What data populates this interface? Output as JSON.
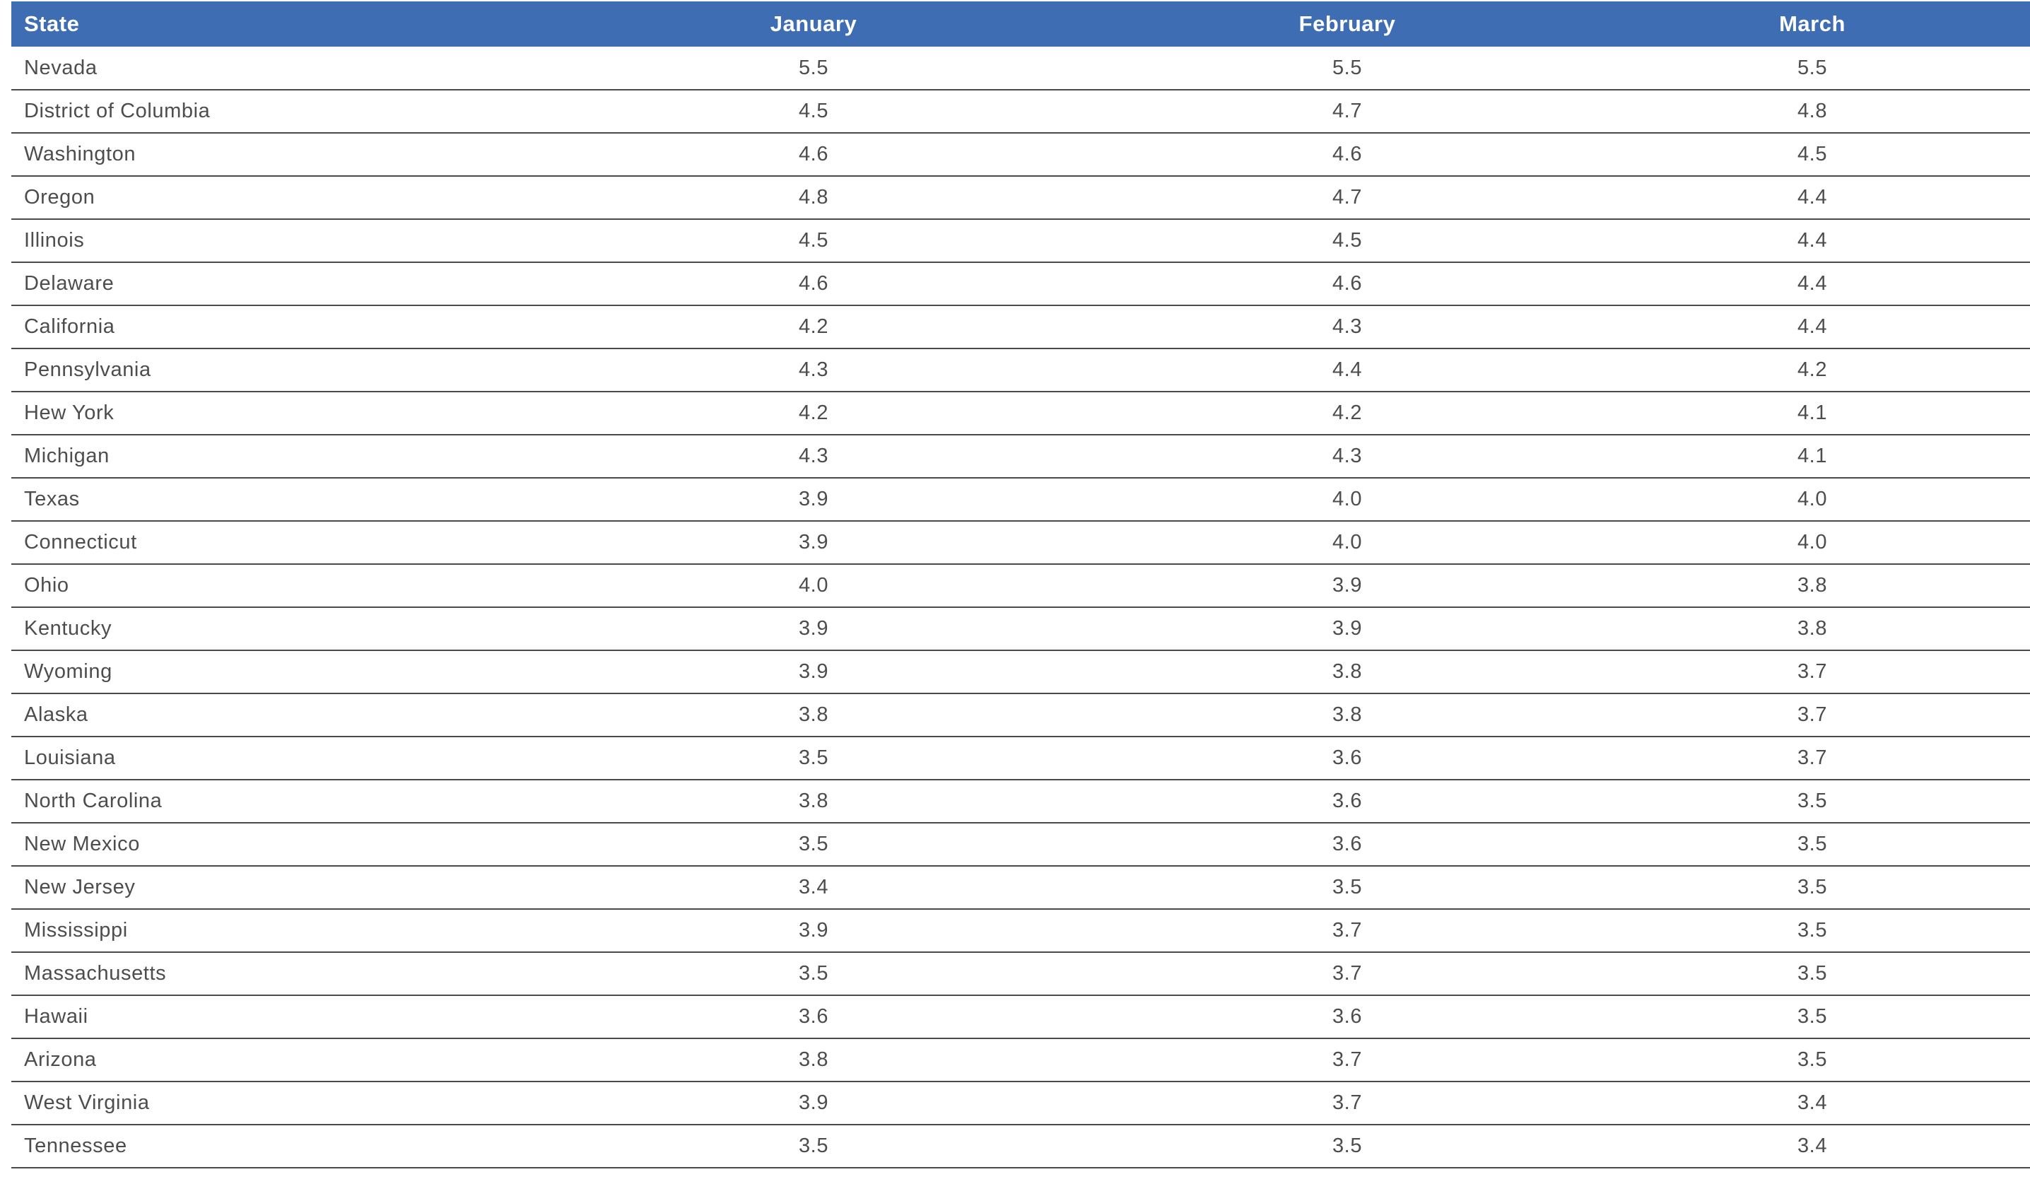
{
  "table": {
    "headers": [
      "State",
      "January",
      "February",
      "March"
    ],
    "rows": [
      [
        "Nevada",
        "5.5",
        "5.5",
        "5.5"
      ],
      [
        "District of Columbia",
        "4.5",
        "4.7",
        "4.8"
      ],
      [
        "Washington",
        "4.6",
        "4.6",
        "4.5"
      ],
      [
        "Oregon",
        "4.8",
        "4.7",
        "4.4"
      ],
      [
        "Illinois",
        "4.5",
        "4.5",
        "4.4"
      ],
      [
        "Delaware",
        "4.6",
        "4.6",
        "4.4"
      ],
      [
        "California",
        "4.2",
        "4.3",
        "4.4"
      ],
      [
        "Pennsylvania",
        "4.3",
        "4.4",
        "4.2"
      ],
      [
        "Hew York",
        "4.2",
        "4.2",
        "4.1"
      ],
      [
        "Michigan",
        "4.3",
        "4.3",
        "4.1"
      ],
      [
        "Texas",
        "3.9",
        "4.0",
        "4.0"
      ],
      [
        "Connecticut",
        "3.9",
        "4.0",
        "4.0"
      ],
      [
        "Ohio",
        "4.0",
        "3.9",
        "3.8"
      ],
      [
        "Kentucky",
        "3.9",
        "3.9",
        "3.8"
      ],
      [
        "Wyoming",
        "3.9",
        "3.8",
        "3.7"
      ],
      [
        "Alaska",
        "3.8",
        "3.8",
        "3.7"
      ],
      [
        "Louisiana",
        "3.5",
        "3.6",
        "3.7"
      ],
      [
        "North Carolina",
        "3.8",
        "3.6",
        "3.5"
      ],
      [
        "New Mexico",
        "3.5",
        "3.6",
        "3.5"
      ],
      [
        "New Jersey",
        "3.4",
        "3.5",
        "3.5"
      ],
      [
        "Mississippi",
        "3.9",
        "3.7",
        "3.5"
      ],
      [
        "Massachusetts",
        "3.5",
        "3.7",
        "3.5"
      ],
      [
        "Hawaii",
        "3.6",
        "3.6",
        "3.5"
      ],
      [
        "Arizona",
        "3.8",
        "3.7",
        "3.5"
      ],
      [
        "West Virginia",
        "3.9",
        "3.7",
        "3.4"
      ],
      [
        "Tennessee",
        "3.5",
        "3.5",
        "3.4"
      ]
    ]
  },
  "colors": {
    "header_bg": "#3f6db3",
    "header_text": "#ffffff",
    "row_divider": "#4a4a4a"
  }
}
